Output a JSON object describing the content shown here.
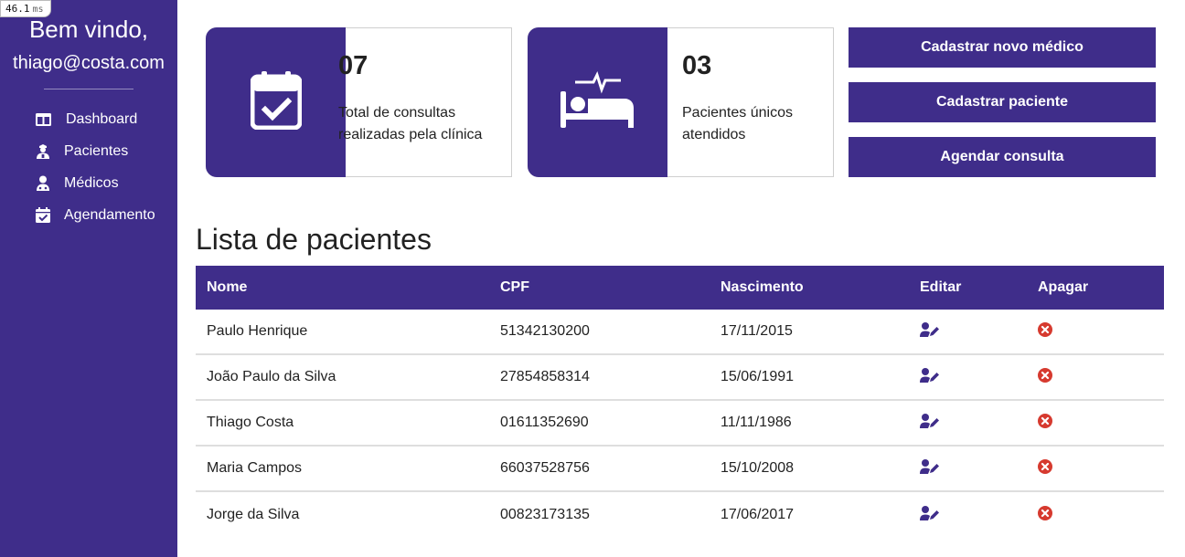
{
  "perf": {
    "value": "46.1",
    "unit": "ms"
  },
  "sidebar": {
    "welcome": "Bem vindo,",
    "email": "thiago@costa.com",
    "items": [
      {
        "label": "Dashboard",
        "icon": "columns-icon"
      },
      {
        "label": "Pacientes",
        "icon": "user-nurse-icon"
      },
      {
        "label": "Médicos",
        "icon": "user-doctor-icon"
      },
      {
        "label": "Agendamento",
        "icon": "calendar-check-icon"
      }
    ]
  },
  "cards": [
    {
      "value": "07",
      "desc": "Total de consultas realizadas pela clínica",
      "icon": "calendar-check-icon"
    },
    {
      "value": "03",
      "desc": "Pacientes únicos atendidos",
      "icon": "bed-pulse-icon"
    }
  ],
  "actions": {
    "new_doctor": "Cadastrar novo médico",
    "new_patient": "Cadastrar paciente",
    "schedule": "Agendar consulta"
  },
  "patients": {
    "title": "Lista de pacientes",
    "headers": {
      "name": "Nome",
      "cpf": "CPF",
      "birth": "Nascimento",
      "edit": "Editar",
      "delete": "Apagar"
    },
    "rows": [
      {
        "name": "Paulo Henrique",
        "cpf": "51342130200",
        "birth": "17/11/2015"
      },
      {
        "name": "João Paulo da Silva",
        "cpf": "27854858314",
        "birth": "15/06/1991"
      },
      {
        "name": "Thiago Costa",
        "cpf": "01611352690",
        "birth": "11/11/1986"
      },
      {
        "name": "Maria Campos",
        "cpf": "66037528756",
        "birth": "15/10/2008"
      },
      {
        "name": "Jorge da Silva",
        "cpf": "00823173135",
        "birth": "17/06/2017"
      }
    ]
  },
  "colors": {
    "primary": "#3f2d8a",
    "danger": "#d63a2f"
  }
}
